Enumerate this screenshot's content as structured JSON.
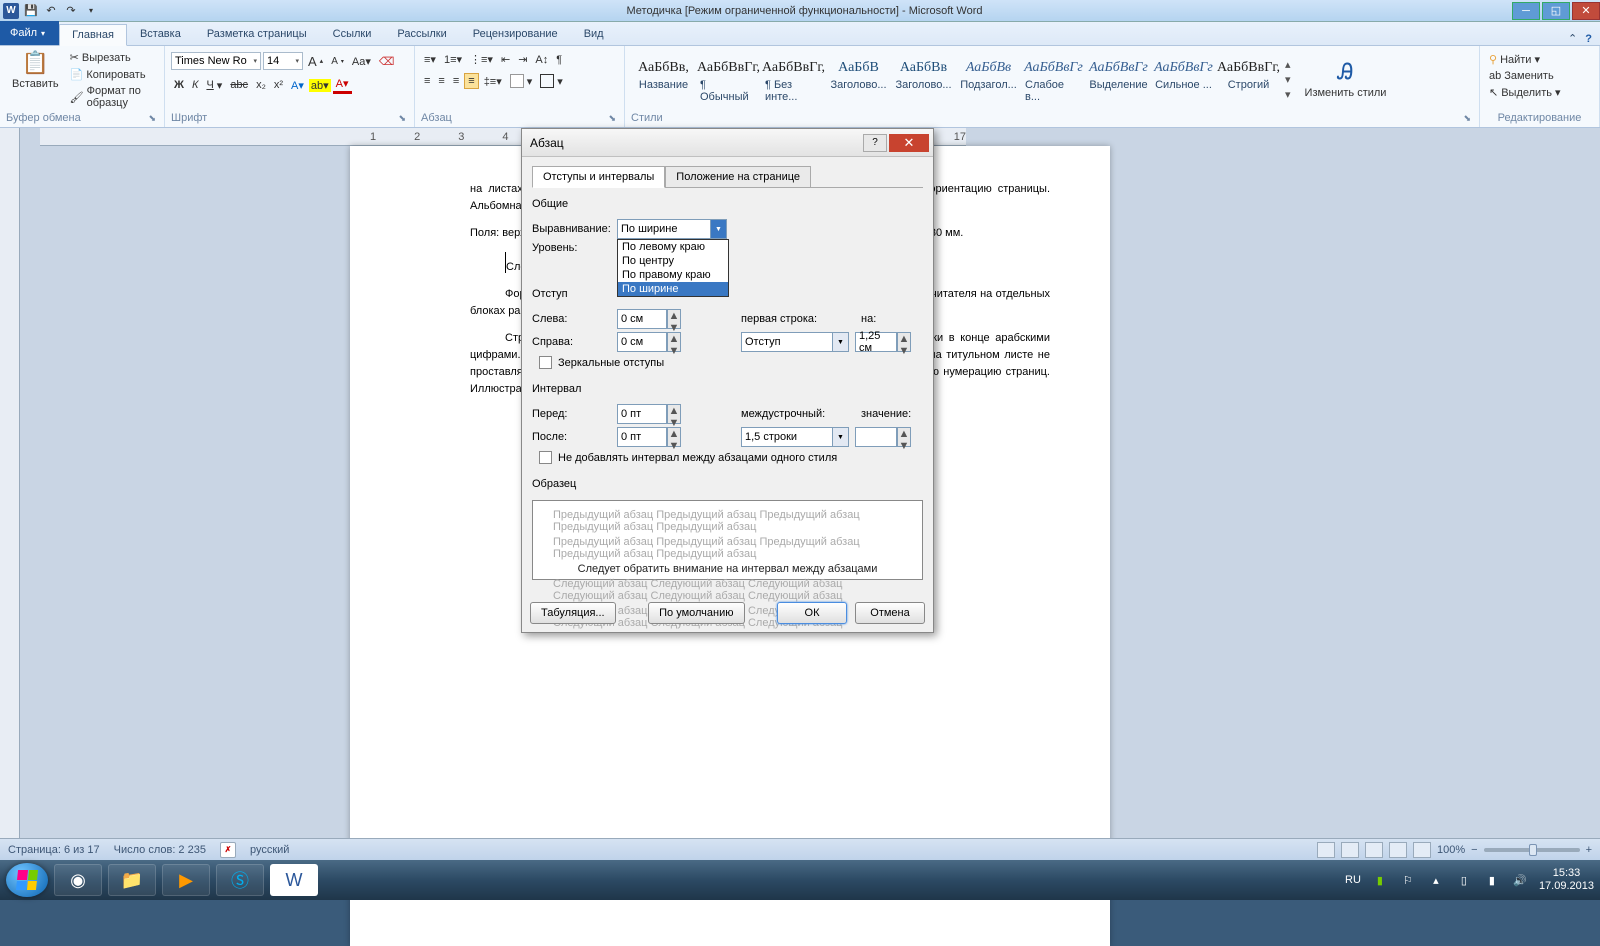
{
  "titlebar": {
    "title": "Методичка [Режим ограниченной функциональности] - Microsoft Word"
  },
  "ribbon": {
    "file": "Файл",
    "tabs": [
      "Главная",
      "Вставка",
      "Разметка страницы",
      "Ссылки",
      "Рассылки",
      "Рецензирование",
      "Вид"
    ],
    "active_tab": "Главная",
    "clipboard": {
      "label": "Буфер обмена",
      "paste": "Вставить",
      "cut": "Вырезать",
      "copy": "Копировать",
      "format_painter": "Формат по образцу"
    },
    "font": {
      "label": "Шрифт",
      "name": "Times New Ro",
      "size": "14"
    },
    "paragraph": {
      "label": "Абзац"
    },
    "styles": {
      "label": "Стили",
      "change": "Изменить стили",
      "items": [
        {
          "preview": "АаБбВв,",
          "name": "Название"
        },
        {
          "preview": "АаБбВвГг,",
          "name": "¶ Обычный"
        },
        {
          "preview": "АаБбВвГг,",
          "name": "¶ Без инте..."
        },
        {
          "preview": "АаБбВ",
          "name": "Заголово...",
          "cls": "blue"
        },
        {
          "preview": "АаБбВв",
          "name": "Заголово...",
          "cls": "blue"
        },
        {
          "preview": "АаБбВв",
          "name": "Подзагол...",
          "cls": "italic"
        },
        {
          "preview": "АаБбВвГг",
          "name": "Слабое в...",
          "cls": "italic"
        },
        {
          "preview": "АаБбВвГг",
          "name": "Выделение",
          "cls": "italic"
        },
        {
          "preview": "АаБбВвГг",
          "name": "Сильное ...",
          "cls": "italic"
        },
        {
          "preview": "АаБбВвГг,",
          "name": "Строгий"
        }
      ]
    },
    "editing": {
      "label": "Редактирование",
      "find": "Найти",
      "replace": "Заменить",
      "select": "Выделить"
    }
  },
  "document": {
    "para1": "на листах белой бумаги формата А4 с одной стороны. Он должен иметь книжную ориентацию страницы. Альбомная допускается только для таблиц и схем приложений.",
    "para2": "Поля: верхнее поле – 20 мм, правое и нижнее поля – 15 мм, левое поле (для подшива) – 30 мм.",
    "para3": "Следует обратить внимание на интервал между абзацами.",
    "para4": "Форматирование основного текста не дает возможности акцентировать внимание читателя на отдельных блоках работы (названиях глав, параграфов и т.д.)",
    "para5": "Страницы проставляются в середине верхней части листа посередине без точки в конце арабскими цифрами. Титульный лист включается в общую нумерацию страниц. Номер страницы на титульном листе не проставляется (нумерация страниц - автоматическая). Приложения включаются в общую нумерацию страниц. Иллюстрации и таблицы на листе формата А3 учитываются как одна страница."
  },
  "dialog": {
    "title": "Абзац",
    "tab_active": "Отступы и интервалы",
    "tab_inactive": "Положение на странице",
    "section_general": "Общие",
    "alignment_label": "Выравнивание:",
    "alignment_value": "По ширине",
    "alignment_options": [
      "По левому краю",
      "По центру",
      "По правому краю",
      "По ширине"
    ],
    "level_label": "Уровень:",
    "section_indent": "Отступ",
    "left_label": "Слева:",
    "left_value": "0 см",
    "right_label": "Справа:",
    "right_value": "0 см",
    "firstline_label": "первая строка:",
    "firstline_value": "Отступ",
    "by_label": "на:",
    "by_value": "1,25 см",
    "mirror": "Зеркальные отступы",
    "section_spacing": "Интервал",
    "before_label": "Перед:",
    "before_value": "0 пт",
    "after_label": "После:",
    "after_value": "0 пт",
    "linesp_label": "междустрочный:",
    "linesp_value": "1,5 строки",
    "at_label": "значение:",
    "at_value": "",
    "nospace": "Не добавлять интервал между абзацами одного стиля",
    "section_sample": "Образец",
    "sample_dark": "Следует обратить внимание на интервал между абзацами",
    "btn_tabs": "Табуляция...",
    "btn_default": "По умолчанию",
    "btn_ok": "ОК",
    "btn_cancel": "Отмена"
  },
  "statusbar": {
    "page": "Страница: 6 из 17",
    "words": "Число слов: 2 235",
    "lang": "русский",
    "zoom": "100%"
  },
  "taskbar": {
    "lang": "RU",
    "time": "15:33",
    "date": "17.09.2013"
  }
}
